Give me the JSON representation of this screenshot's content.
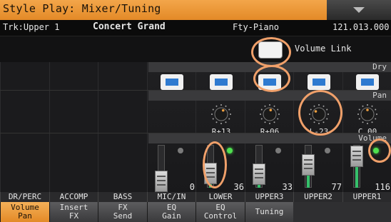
{
  "title": "Style Play: Mixer/Tuning",
  "info": {
    "track": "Trk:Upper 1",
    "sound": "Concert Grand",
    "category": "Fty-Piano",
    "bank": "121.013.000"
  },
  "volume_link": {
    "label": "Volume Link",
    "checked": false
  },
  "sections": {
    "dry": "Dry",
    "pan": "Pan",
    "volume": "Volume"
  },
  "channels": [
    {
      "name": "DR/PERC",
      "active": false
    },
    {
      "name": "ACCOMP",
      "active": false
    },
    {
      "name": "BASS",
      "active": false
    },
    {
      "name": "MIC/IN",
      "active": true,
      "pan": "",
      "volume": "0",
      "level": 0,
      "led": false
    },
    {
      "name": "LOWER",
      "active": true,
      "pan": "R+13",
      "volume": "36",
      "level": 0.28,
      "led": true
    },
    {
      "name": "UPPER3",
      "active": true,
      "pan": "R+06",
      "volume": "33",
      "level": 0.26,
      "led": false
    },
    {
      "name": "UPPER2",
      "active": true,
      "pan": "L-23",
      "volume": "77",
      "level": 0.6,
      "led": false
    },
    {
      "name": "UPPER1",
      "active": true,
      "pan": "C 00",
      "volume": "116",
      "level": 0.91,
      "led": true
    }
  ],
  "tabs": [
    {
      "line1": "Volume",
      "line2": "Pan",
      "active": true
    },
    {
      "line1": "Insert",
      "line2": "FX",
      "active": false
    },
    {
      "line1": "FX",
      "line2": "Send",
      "active": false
    },
    {
      "line1": "EQ",
      "line2": "Gain",
      "active": false
    },
    {
      "line1": "EQ",
      "line2": "Control",
      "active": false
    },
    {
      "line1": "Tuning",
      "line2": "",
      "active": false
    }
  ],
  "colors": {
    "accent": "#e38a27",
    "highlight": "#f0a06a",
    "led_on": "#4fe04f",
    "dry_button": "#2e7ad0"
  }
}
